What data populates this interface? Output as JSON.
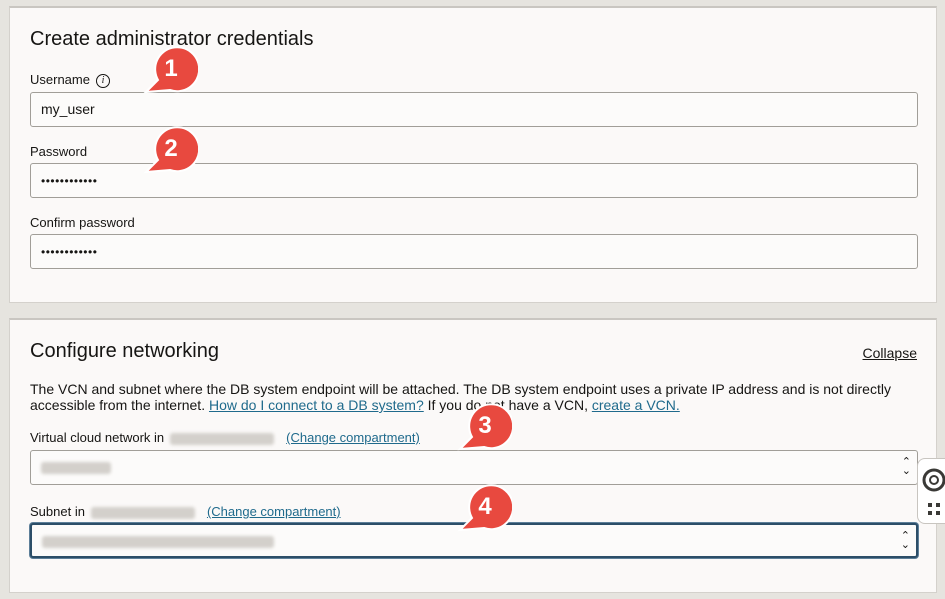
{
  "credentials": {
    "title": "Create administrator credentials",
    "username_label": "Username",
    "username_value": "my_user",
    "password_label": "Password",
    "password_value": "••••••••••••",
    "confirm_label": "Confirm password",
    "confirm_value": "••••••••••••"
  },
  "networking": {
    "title": "Configure networking",
    "collapse_label": "Collapse",
    "desc_text_1": "The VCN and subnet where the DB system endpoint will be attached. The DB system endpoint uses a private IP address and is not directly accessible from the internet.",
    "desc_link_1": "How do I connect to a DB system?",
    "desc_text_2": "If you do not have a VCN,",
    "desc_link_2": "create a VCN.",
    "vcn_label": "Virtual cloud network in",
    "vcn_change": "(Change compartment)",
    "subnet_label": "Subnet in",
    "subnet_change": "(Change compartment)"
  },
  "markers": [
    "1",
    "2",
    "3",
    "4"
  ],
  "icons": {
    "info": "info-icon",
    "select": "chevron-updown-icon",
    "help": "lifebuoy-icon",
    "apps": "grid-dots-icon"
  },
  "colors": {
    "marker": "#e8493f",
    "link": "#1f6a8c",
    "focus": "#2c4e68"
  }
}
